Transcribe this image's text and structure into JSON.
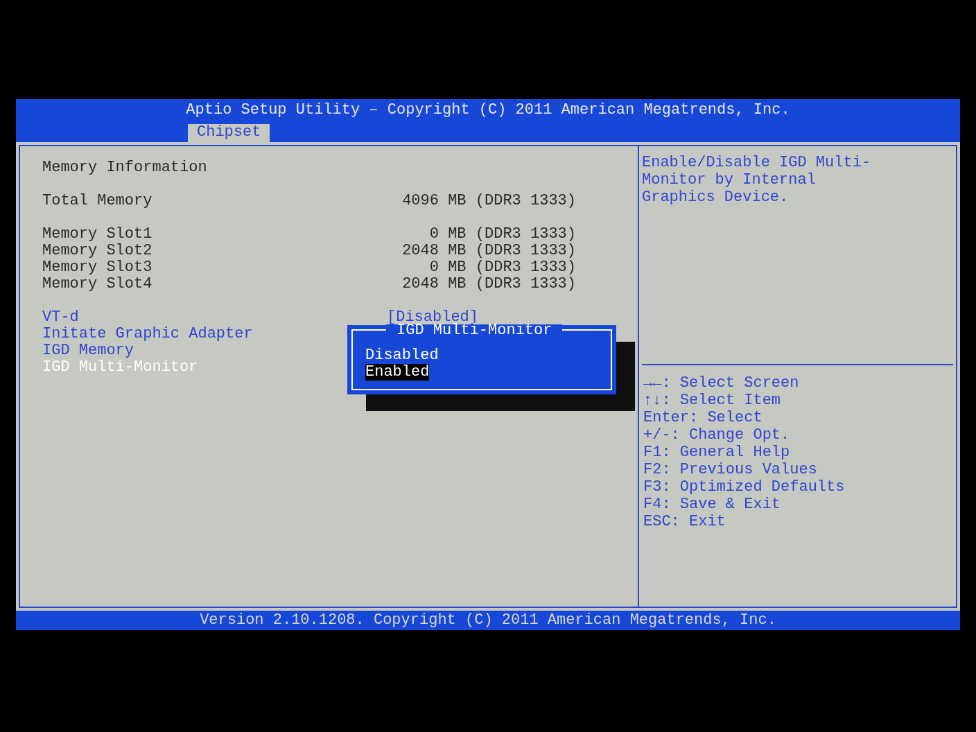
{
  "header": {
    "title": "Aptio Setup Utility – Copyright (C) 2011 American Megatrends, Inc.",
    "tabs": [
      {
        "label": "Chipset",
        "selected": true
      }
    ]
  },
  "settings": {
    "groups": [
      [
        {
          "kind": "heading",
          "label": "Memory Information"
        }
      ],
      [
        {
          "kind": "info",
          "label": "Total Memory",
          "value": "4096 MB (DDR3 1333)"
        }
      ],
      [
        {
          "kind": "info",
          "label": "Memory Slot1",
          "value": "0 MB (DDR3 1333)"
        },
        {
          "kind": "info",
          "label": "Memory Slot2",
          "value": "2048 MB (DDR3 1333)"
        },
        {
          "kind": "info",
          "label": "Memory Slot3",
          "value": "0 MB (DDR3 1333)"
        },
        {
          "kind": "info",
          "label": "Memory Slot4",
          "value": "2048 MB (DDR3 1333)"
        }
      ],
      [
        {
          "kind": "option",
          "label": "VT-d",
          "value": "[Disabled]",
          "selected": false
        },
        {
          "kind": "option",
          "label": "Initate Graphic Adapter",
          "selected": false
        },
        {
          "kind": "option",
          "label": "IGD Memory",
          "selected": false
        },
        {
          "kind": "option",
          "label": "IGD Multi-Monitor",
          "selected": true
        }
      ]
    ]
  },
  "popup": {
    "title": "IGD Multi-Monitor",
    "options": [
      {
        "label": "Disabled",
        "selected": false
      },
      {
        "label": "Enabled",
        "selected": true
      }
    ]
  },
  "help": {
    "description": "Enable/Disable IGD Multi-Monitor by Internal Graphics Device.",
    "keys": [
      "→←: Select Screen",
      "↑↓: Select Item",
      "Enter: Select",
      "+/-: Change Opt.",
      "F1: General Help",
      "F2: Previous Values",
      "F3: Optimized Defaults",
      "F4: Save & Exit",
      "ESC: Exit"
    ]
  },
  "footer": "Version 2.10.1208. Copyright (C) 2011 American Megatrends, Inc."
}
